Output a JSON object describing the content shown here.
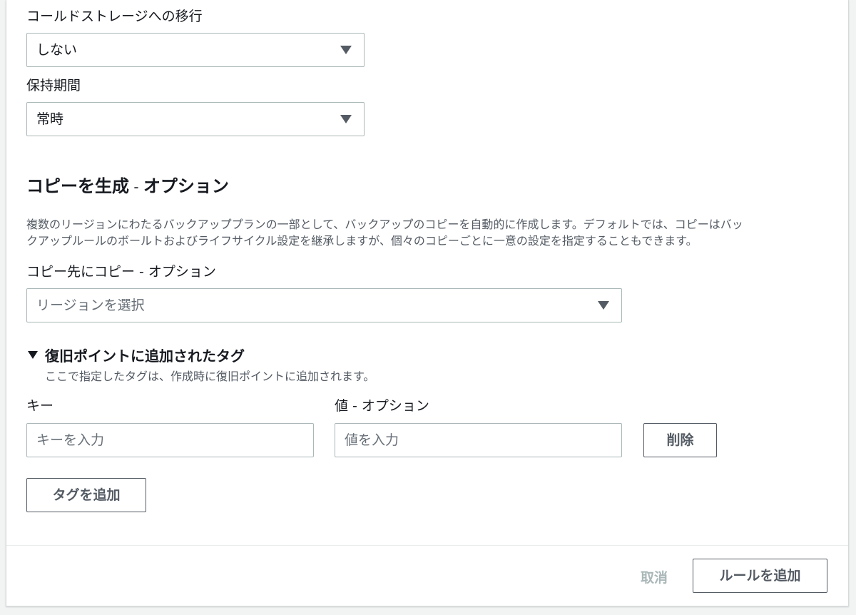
{
  "cold_storage": {
    "label": "コールドストレージへの移行",
    "value": "しない"
  },
  "retention": {
    "label": "保持期間",
    "value": "常時"
  },
  "copy_section": {
    "title_main": "コピーを生成",
    "title_sep": " - ",
    "title_opt": "オプション",
    "description_line1": "複数のリージョンにわたるバックアッププランの一部として、バックアップのコピーを自動的に作成します。デフォルトでは、コピーはバッ",
    "description_line2": "クアップルールのボールトおよびライフサイクル設定を継承しますが、個々のコピーごとに一意の設定を指定することもできます。",
    "destination_label": "コピー先にコピー - オプション",
    "destination_placeholder": "リージョンを選択"
  },
  "tags_section": {
    "title": "復旧ポイントに追加されたタグ",
    "hint": "ここで指定したタグは、作成時に復旧ポイントに追加されます。",
    "key_label": "キー",
    "value_label": "値 - オプション",
    "key_placeholder": "キーを入力",
    "value_placeholder": "値を入力",
    "remove_label": "削除",
    "add_tag_label": "タグを追加"
  },
  "footer": {
    "cancel_label": "取消",
    "submit_label": "ルールを追加"
  },
  "colors": {
    "border": "#aab7b8",
    "text": "#16191f",
    "muted": "#545b64",
    "disabled": "#aab7b8",
    "background": "#f2f3f3"
  }
}
